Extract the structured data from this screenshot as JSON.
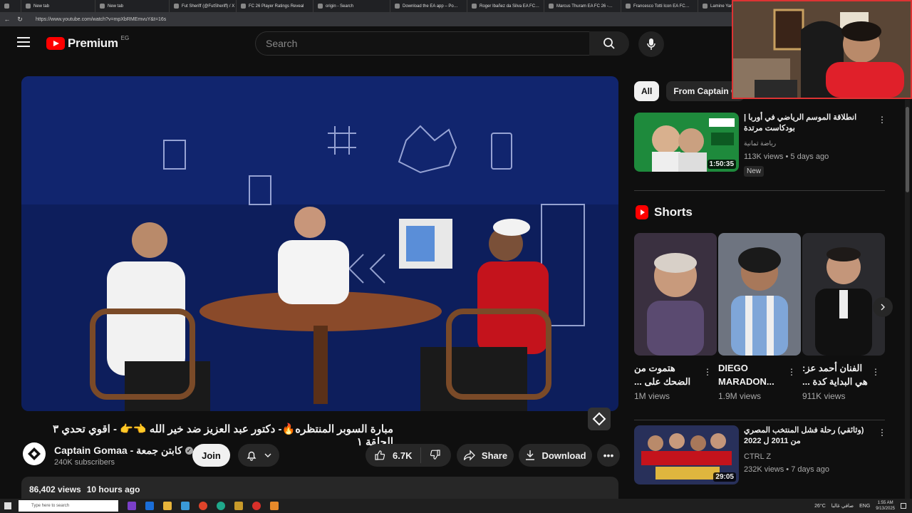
{
  "browser": {
    "tabs": [
      "New tab",
      "New tab",
      "Fut Sheriff (@FutSheriff) / X",
      "FC 26 Player Ratings Reveal",
      "origin - Search",
      "Download the EA app – Po…",
      "Roger Ibañez da Silva EA FC…",
      "Marcus Thuram EA FC 26 -…",
      "Francesco Totti Icon EA FC…",
      "Lamine Yamal Nas"
    ],
    "url": "https://www.youtube.com/watch?v=mpXbRMEmvuY&t=16s"
  },
  "header": {
    "brand": "Premium",
    "country": "EG",
    "search_placeholder": "Search"
  },
  "video": {
    "title": "مبارة السوبر المنتظره🔥- دكتور عبد العزيز ضد خير الله 👈👉 - اقوي تحدي ٣ الحلقة ١",
    "channel": "Captain Gomaa - كابتن جمعة",
    "subscribers": "240K subscribers",
    "join": "Join",
    "likes": "6.7K",
    "share": "Share",
    "download": "Download",
    "views": "86,402 views",
    "age": "10 hours ago"
  },
  "chips": [
    "All",
    "From Captain G"
  ],
  "recommendations": [
    {
      "title": "انطلاقة الموسم الرياضي في أوربا | بودكاست مرتدة",
      "channel": "رياضة ثمانية",
      "meta": "113K views • 5 days ago",
      "duration": "1:50:35",
      "badge": "New"
    },
    {
      "title": "(وثائقي) رحلة فشل المنتخب المصري من 2011 ل 2022",
      "channel": "CTRL Z",
      "meta": "232K views • 7 days ago",
      "duration": "29:05"
    }
  ],
  "shorts": {
    "heading": "Shorts",
    "items": [
      {
        "title": "هتموت من الضحك على ...",
        "views": "1M views"
      },
      {
        "title": "DIEGO MARADON...",
        "views": "1.9M views"
      },
      {
        "title": "الفنان أحمد عز: هي البداية كدة ...",
        "views": "911K views"
      }
    ]
  },
  "taskbar": {
    "search": "Type here to search",
    "weather": "26°C",
    "weather_ar": "صافي غالبا",
    "lang": "ENG",
    "time": "1:55 AM",
    "date": "9/13/2025"
  },
  "colors": {
    "accent": "#ff0000",
    "bg": "#0f0f0f"
  }
}
